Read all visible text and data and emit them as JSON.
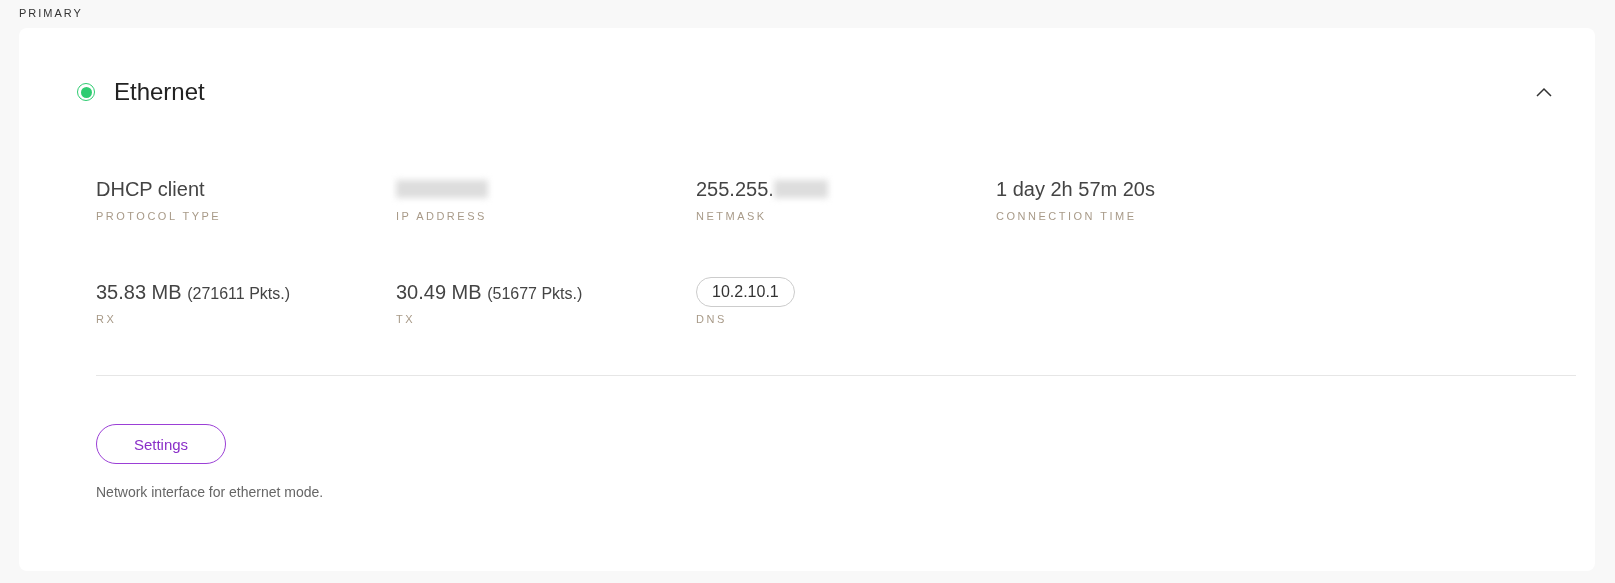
{
  "section_label": "PRIMARY",
  "interface": {
    "name": "Ethernet",
    "connected": true,
    "expanded": true
  },
  "stats": [
    {
      "kind": "text",
      "value": "DHCP client",
      "label": "PROTOCOL TYPE"
    },
    {
      "kind": "text",
      "label": "IP ADDRESS",
      "redacted": true
    },
    {
      "kind": "text",
      "value": "255.255.",
      "label": "NETMASK",
      "redacted": true
    },
    {
      "kind": "text",
      "value": "1 day 2h 57m 20s",
      "label": "CONNECTION TIME"
    },
    {
      "kind": "traffic",
      "value": "35.83 MB",
      "detail": "(271611 Pkts.)",
      "label": "RX"
    },
    {
      "kind": "traffic",
      "value": "30.49 MB",
      "detail": "(51677 Pkts.)",
      "label": "TX"
    },
    {
      "kind": "chip",
      "value": "10.2.10.1",
      "label": "DNS"
    }
  ],
  "settings_button": "Settings",
  "description": "Network interface for ethernet mode."
}
